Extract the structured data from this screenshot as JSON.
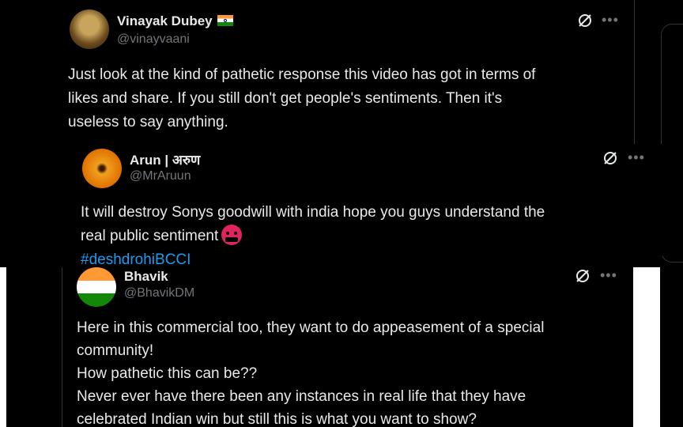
{
  "tweets": [
    {
      "name": "Vinayak Dubey",
      "handle": "@vinayvaani",
      "lines": [
        "Just look at the kind of pathetic response this video has got in terms of",
        "likes and share. If you still don't get people's sentiments. Then it's",
        "useless to say anything."
      ]
    },
    {
      "name": "Arun | अरुण",
      "handle": "@MrAruun",
      "lines": [
        "It will destroy Sonys goodwill with india hope you guys understand the",
        "real public sentiment"
      ],
      "hashtag": "#deshdrohiBCCI"
    },
    {
      "name": "Bhavik",
      "handle": "@BhavikDM",
      "lines": [
        "Here in this commercial too, they want to do appeasement of a special",
        "community!",
        "How pathetic this can be??",
        "Never ever have there been any instances in real life that they have",
        "celebrated Indian win but still this is what you want to show?"
      ]
    }
  ],
  "more_label": "•••",
  "colors": {
    "background": "#000000",
    "text": "#e7e9ea",
    "muted": "#71767b",
    "link": "#1d9bf0",
    "divider": "#2f3336"
  }
}
